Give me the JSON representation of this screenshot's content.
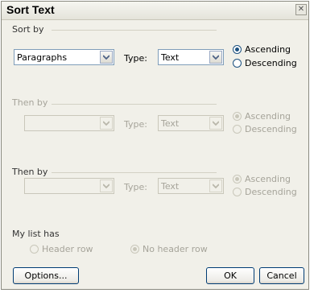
{
  "dialog": {
    "title": "Sort Text"
  },
  "sort_by": {
    "label": "Sort by",
    "field": "Paragraphs",
    "type_label": "Type:",
    "type": "Text",
    "ascending_label": "Ascending",
    "descending_label": "Descending",
    "order": "ascending"
  },
  "then_by_1": {
    "label": "Then by",
    "field": "",
    "type_label": "Type:",
    "type": "Text",
    "ascending_label": "Ascending",
    "descending_label": "Descending",
    "enabled": false
  },
  "then_by_2": {
    "label": "Then by",
    "field": "",
    "type_label": "Type:",
    "type": "Text",
    "ascending_label": "Ascending",
    "descending_label": "Descending",
    "enabled": false
  },
  "my_list_has": {
    "label": "My list has",
    "header_row_label": "Header row",
    "no_header_row_label": "No header row",
    "selected": "no_header_row"
  },
  "buttons": {
    "options": "Options...",
    "ok": "OK",
    "cancel": "Cancel"
  },
  "icons": {
    "close": "close-icon",
    "dropdown": "chevron-down-icon"
  }
}
